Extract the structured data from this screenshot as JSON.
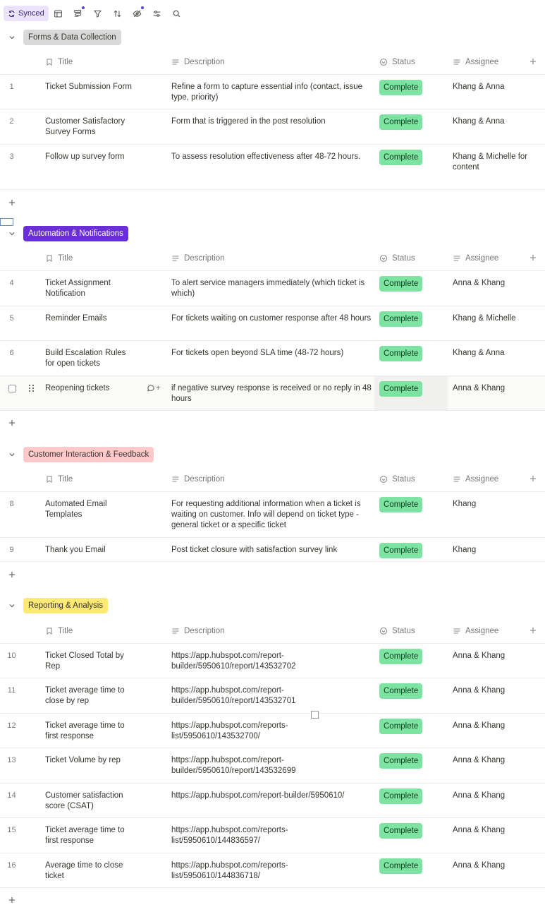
{
  "toolbar": {
    "synced_label": "Synced",
    "icons": [
      "sync-icon",
      "table-icon",
      "group-icon",
      "filter-icon",
      "sort-icon",
      "hide-icon",
      "settings-sliders-icon",
      "search-icon"
    ]
  },
  "columns": {
    "title": "Title",
    "description": "Description",
    "status": "Status",
    "assignee": "Assignee"
  },
  "groups": [
    {
      "label": "Forms & Data Collection",
      "color": "#d9d9d9",
      "rows": [
        {
          "num": "1",
          "title": "Ticket Submission Form",
          "description": "Refine a form to capture essential info (contact, issue type, priority)",
          "status": "Complete",
          "assignee": "Khang & Anna"
        },
        {
          "num": "2",
          "title": "Customer Satisfactory Survey Forms",
          "description": "Form that is triggered in the post resolution",
          "status": "Complete",
          "assignee": "Khang & Anna"
        },
        {
          "num": "3",
          "title": "Follow up survey form",
          "description": "To assess resolution effectiveness after 48-72 hours.",
          "status": "Complete",
          "assignee": "Khang & Michelle for content"
        }
      ]
    },
    {
      "label": "Automation & Notifications",
      "color": "#6a2fd6",
      "rows": [
        {
          "num": "4",
          "title": "Ticket Assignment Notification",
          "description": "To alert service managers immediately (which ticket is which)",
          "status": "Complete",
          "assignee": "Anna & Khang"
        },
        {
          "num": "5",
          "title": "Reminder Emails",
          "description": "For tickets waiting on customer response after 48 hours",
          "status": "Complete",
          "assignee": "Khang & Michelle"
        },
        {
          "num": "6",
          "title": "Build Escalation Rules for open tickets",
          "description": "For tickets open beyond SLA time (48-72 hours)",
          "status": "Complete",
          "assignee": "Khang & Anna"
        },
        {
          "num": "",
          "title": "Reopening tickets",
          "description": "if negative survey response is received or no reply in 48 hours",
          "status": "Complete",
          "assignee": "Anna & Khang",
          "comment_label": "+"
        }
      ]
    },
    {
      "label": "Customer Interaction & Feedback",
      "color": "#ffc9c9",
      "rows": [
        {
          "num": "8",
          "title": "Automated Email Templates",
          "description": "For requesting additional information when a ticket is waiting on customer. Info will depend on ticket type - general ticket or a specific ticket",
          "status": "Complete",
          "assignee": "Khang"
        },
        {
          "num": "9",
          "title": "Thank you Email",
          "description": "Post ticket closure with satisfaction survey link",
          "status": "Complete",
          "assignee": "Khang"
        }
      ]
    },
    {
      "label": "Reporting & Analysis",
      "color": "#fde974",
      "rows": [
        {
          "num": "10",
          "title": "Ticket Closed Total by Rep",
          "description": "https://app.hubspot.com/report-builder/5950610/report/143532702",
          "status": "Complete",
          "assignee": "Anna & Khang"
        },
        {
          "num": "11",
          "title": "Ticket average time to close by rep",
          "description": "https://app.hubspot.com/report-builder/5950610/report/143532701",
          "status": "Complete",
          "assignee": "Anna & Khang"
        },
        {
          "num": "12",
          "title": "Ticket average time to first response",
          "description": "https://app.hubspot.com/reports-list/5950610/143532700/",
          "status": "Complete",
          "assignee": "Anna & Khang"
        },
        {
          "num": "13",
          "title": "Ticket Volume by rep",
          "description": "https://app.hubspot.com/report-builder/5950610/report/143532699",
          "status": "Complete",
          "assignee": "Anna & Khang"
        },
        {
          "num": "14",
          "title": "Customer satisfaction score (CSAT)",
          "description": "https://app.hubspot.com/report-builder/5950610/",
          "status": "Complete",
          "assignee": "Anna & Khang"
        },
        {
          "num": "15",
          "title": "Ticket average time to first response",
          "description": "https://app.hubspot.com/reports-list/5950610/144836597/",
          "status": "Complete",
          "assignee": "Anna & Khang"
        },
        {
          "num": "16",
          "title": "Average time to close ticket",
          "description": "https://app.hubspot.com/reports-list/5950610/144836718/",
          "status": "Complete",
          "assignee": "Anna & Khang"
        }
      ]
    }
  ]
}
